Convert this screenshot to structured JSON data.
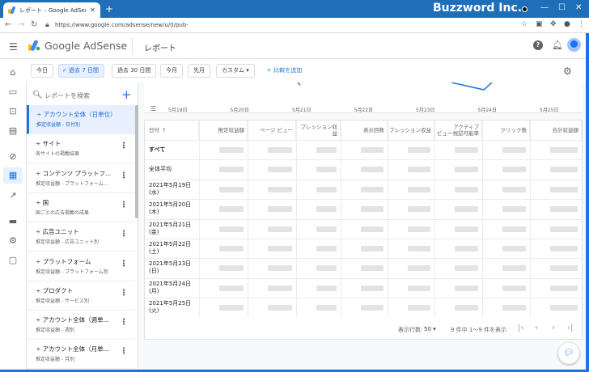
{
  "browser": {
    "tab_title": "レポート – Google AdSense",
    "new_tab": "+",
    "overlay_brand": "Buzzword Inc.",
    "url": "https://www.google.com/adsense/new/u/0/pub-"
  },
  "header": {
    "product": "Google AdSense",
    "page_title": "レポート"
  },
  "toolbar": {
    "chips": [
      "今日",
      "過去 7 日間",
      "過去 30 日間",
      "今月",
      "先月",
      "カスタム"
    ],
    "selected_chip": "過去 7 日間",
    "compare": "比較を追加"
  },
  "reports": {
    "search_placeholder": "レポートを検索",
    "items": [
      {
        "title": "アカウント全体（日単位）",
        "subtitle": "推定収益額 - 日付別"
      },
      {
        "title": "サイト",
        "subtitle": "各サイトの掲載結果"
      },
      {
        "title": "コンテンツ プラットフ...",
        "subtitle": "推定収益額 - プラットフォーム..."
      },
      {
        "title": "国",
        "subtitle": "国ごとの広告掲載の成果"
      },
      {
        "title": "広告ユニット",
        "subtitle": "推定収益額 - 広告ユニット別"
      },
      {
        "title": "プラットフォーム",
        "subtitle": "推定収益額 - プラットフォーム別"
      },
      {
        "title": "プロダクト",
        "subtitle": "推定収益額 - サービス別"
      },
      {
        "title": "アカウント全体（週単...",
        "subtitle": "推定収益額 - 週別"
      },
      {
        "title": "アカウント全体（月単...",
        "subtitle": "推定収益額 - 月別"
      }
    ]
  },
  "chart": {
    "x_ticks": [
      "5月19日",
      "5月20日",
      "5月21日",
      "5月22日",
      "5月23日",
      "5月24日",
      "5月25日"
    ]
  },
  "table": {
    "headers": [
      "日付",
      "推定収益額",
      "ページ ビュー",
      "プレッション収益",
      "表示回数",
      "プレッション収益",
      "アクティブ ビュー視認可能率",
      "クリック数",
      "合計収益額"
    ],
    "header_lines": [
      [
        "日付"
      ],
      [
        "推定収益額"
      ],
      [
        "ページ ビュー"
      ],
      [
        "プレッション収益"
      ],
      [
        "表示回数"
      ],
      [
        "プレッション収益"
      ],
      [
        "アクティブ",
        "ビュー視認可能率"
      ],
      [
        "クリック数"
      ],
      [
        "合計収益額"
      ]
    ],
    "rows": [
      {
        "date": "すべて"
      },
      {
        "date": "全体平均"
      },
      {
        "date": "2021年5月19日",
        "weekday": "(水)"
      },
      {
        "date": "2021年5月20日",
        "weekday": "(木)"
      },
      {
        "date": "2021年5月21日",
        "weekday": "(金)"
      },
      {
        "date": "2021年5月22日",
        "weekday": "(土)"
      },
      {
        "date": "2021年5月23日",
        "weekday": "(日)"
      },
      {
        "date": "2021年5月24日",
        "weekday": "(月)"
      },
      {
        "date": "2021年5月25日",
        "weekday": "(火)"
      }
    ]
  },
  "pager": {
    "rows_label": "表示行数:",
    "rows_value": "50",
    "range": "9 件中 1〜9 件を表示"
  },
  "colors": {
    "brand_blue": "#1a73e8",
    "selected_bg": "#e8f0fe"
  }
}
